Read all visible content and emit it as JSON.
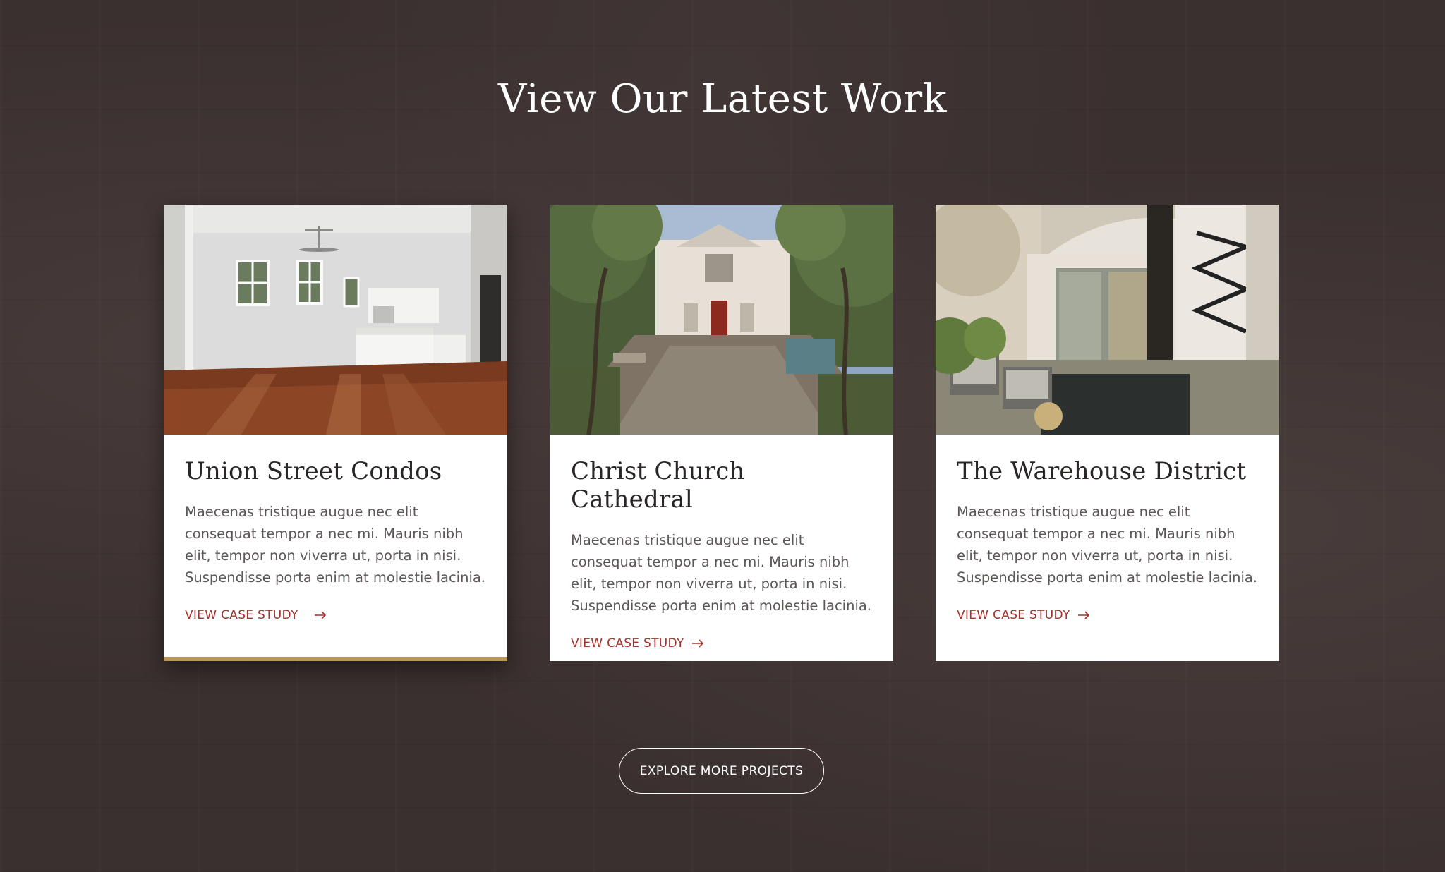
{
  "section": {
    "title": "View Our Latest Work"
  },
  "cards": [
    {
      "title": "Union Street Condos",
      "text": "Maecenas tristique augue nec elit consequat tempor a nec mi. Mauris nibh elit, tempor non viverra ut, porta in nisi. Suspendisse porta enim at molestie lacinia.",
      "link_label": "VIEW CASE STUDY",
      "image": "kitchen-interior-photo"
    },
    {
      "title": "Christ Church Cathedral",
      "text": "Maecenas tristique augue nec elit consequat tempor a nec mi. Mauris nibh elit, tempor non viverra ut, porta in nisi. Suspendisse porta enim at molestie lacinia.",
      "link_label": "VIEW CASE STUDY",
      "image": "cathedral-courtyard-photo"
    },
    {
      "title": "The Warehouse District",
      "text": "Maecenas tristique augue nec elit consequat tempor a nec mi. Mauris nibh elit, tempor non viverra ut, porta in nisi. Suspendisse porta enim at molestie lacinia.",
      "link_label": "VIEW CASE STUDY",
      "image": "patio-exterior-photo"
    }
  ],
  "cta": {
    "explore_label": "EXPLORE MORE PROJECTS"
  },
  "colors": {
    "background": "#3b3030",
    "accent_link": "#a2322b",
    "accent_bar": "#b9975b",
    "card": "#ffffff"
  },
  "icons": {
    "link_arrow": "arrow-right-icon"
  }
}
